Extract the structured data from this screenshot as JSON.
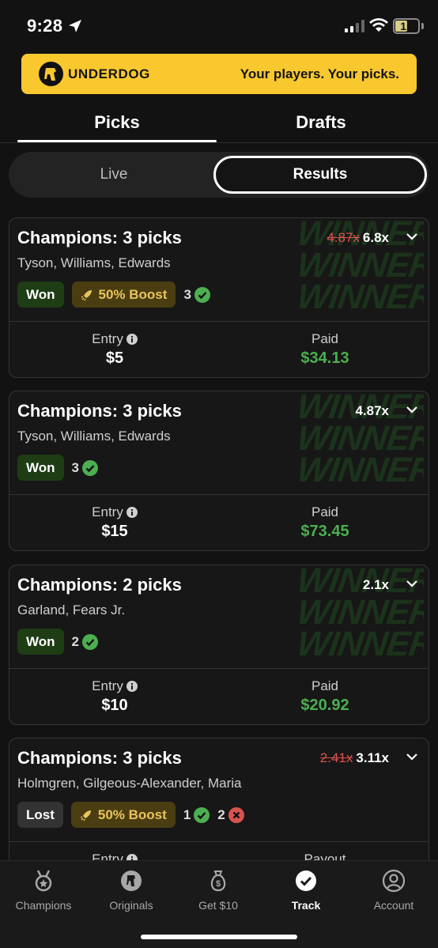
{
  "status": {
    "time": "9:28",
    "battery": "15"
  },
  "banner": {
    "brand": "UNDERDOG",
    "tagline": "Your players. Your picks."
  },
  "tabs": [
    {
      "label": "Picks"
    },
    {
      "label": "Drafts"
    }
  ],
  "segment": {
    "live": "Live",
    "results": "Results"
  },
  "cards": [
    {
      "title": "Champions: 3 picks",
      "players": "Tyson, Williams, Edwards",
      "old_multiplier": "4.87x",
      "multiplier": "6.8x",
      "status": "Won",
      "boost": "50% Boost",
      "won_count": "3",
      "entry_label": "Entry",
      "entry": "$5",
      "result_label": "Paid",
      "result": "$34.13",
      "watermark": "WINNER!!"
    },
    {
      "title": "Champions: 3 picks",
      "players": "Tyson, Williams, Edwards",
      "multiplier": "4.87x",
      "status": "Won",
      "won_count": "3",
      "entry_label": "Entry",
      "entry": "$15",
      "result_label": "Paid",
      "result": "$73.45",
      "watermark": "WINNER!!"
    },
    {
      "title": "Champions: 2 picks",
      "players": "Garland, Fears Jr.",
      "multiplier": "2.1x",
      "status": "Won",
      "won_count": "2",
      "entry_label": "Entry",
      "entry": "$10",
      "result_label": "Paid",
      "result": "$20.92",
      "watermark": "WINNER!!"
    },
    {
      "title": "Champions: 3 picks",
      "players": "Holmgren, Gilgeous-Alexander, Maria",
      "old_multiplier": "2.41x",
      "multiplier": "3.11x",
      "status": "Lost",
      "boost": "50% Boost",
      "won_count": "1",
      "lost_count": "2",
      "entry_label": "Entry",
      "result_label": "Payout"
    }
  ],
  "nav": [
    {
      "label": "Champions",
      "icon": "medal-icon"
    },
    {
      "label": "Originals",
      "icon": "underdog-icon"
    },
    {
      "label": "Get $10",
      "icon": "money-bag-icon"
    },
    {
      "label": "Track",
      "icon": "check-circle-icon"
    },
    {
      "label": "Account",
      "icon": "user-icon"
    }
  ],
  "colors": {
    "accent": "#f9c82f",
    "win_green": "#4caf50",
    "loss_red": "#d9534f",
    "boost_gold": "#e9c35b"
  }
}
